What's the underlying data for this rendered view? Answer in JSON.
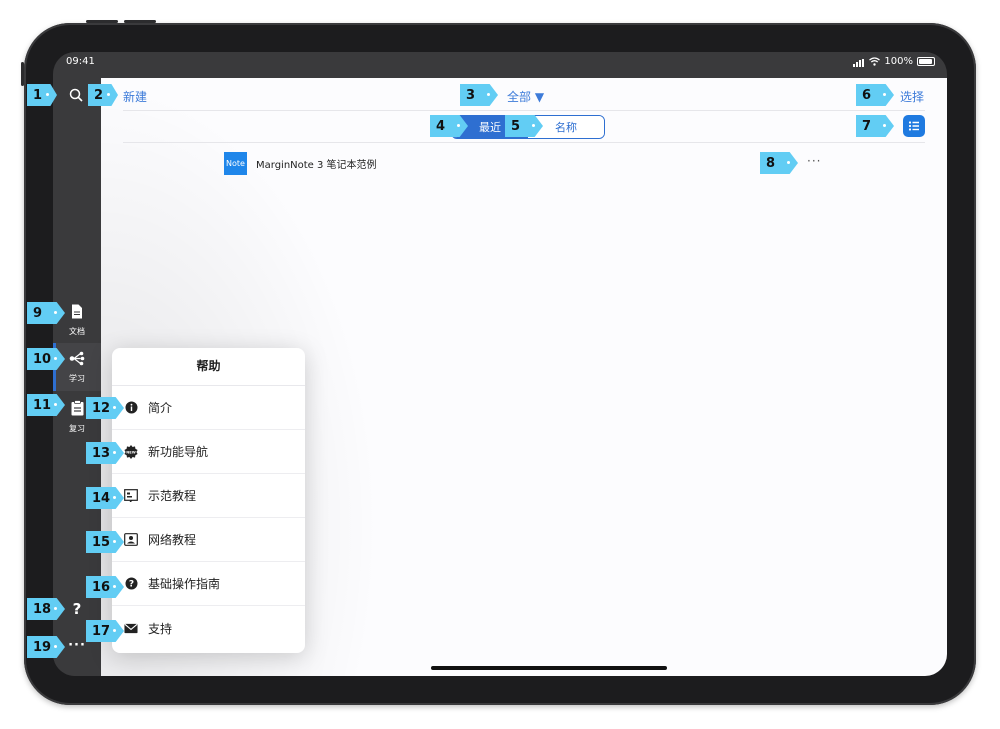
{
  "status_bar": {
    "time": "09:41",
    "battery_text": "100%"
  },
  "toolbar": {
    "new_label": "新建",
    "filter_label": "全部 ▼",
    "select_label": "选择"
  },
  "sort": {
    "recent_label": "最近",
    "name_label": "名称"
  },
  "notebooks": [
    {
      "thumb_text": "Note",
      "title": "MarginNote 3 笔记本范例",
      "more": "···"
    }
  ],
  "sidebar": {
    "documents_label": "文档",
    "study_label": "学习",
    "review_label": "复习",
    "help_glyph": "?",
    "more_glyph": "···"
  },
  "help_menu": {
    "title": "帮助",
    "items": [
      {
        "label": "简介",
        "icon": "info-icon"
      },
      {
        "label": "新功能导航",
        "icon": "new-badge-icon"
      },
      {
        "label": "示范教程",
        "icon": "tutorial-icon"
      },
      {
        "label": "网络教程",
        "icon": "web-tutorial-icon"
      },
      {
        "label": "基础操作指南",
        "icon": "question-icon"
      },
      {
        "label": "支持",
        "icon": "mail-icon"
      }
    ]
  },
  "callouts": [
    "1",
    "2",
    "3",
    "4",
    "5",
    "6",
    "7",
    "8",
    "9",
    "10",
    "11",
    "12",
    "13",
    "14",
    "15",
    "16",
    "17",
    "18",
    "19"
  ],
  "colors": {
    "accent": "#2e6fd1",
    "callout": "#62cdf4",
    "sidebar": "#3a3a3c"
  }
}
